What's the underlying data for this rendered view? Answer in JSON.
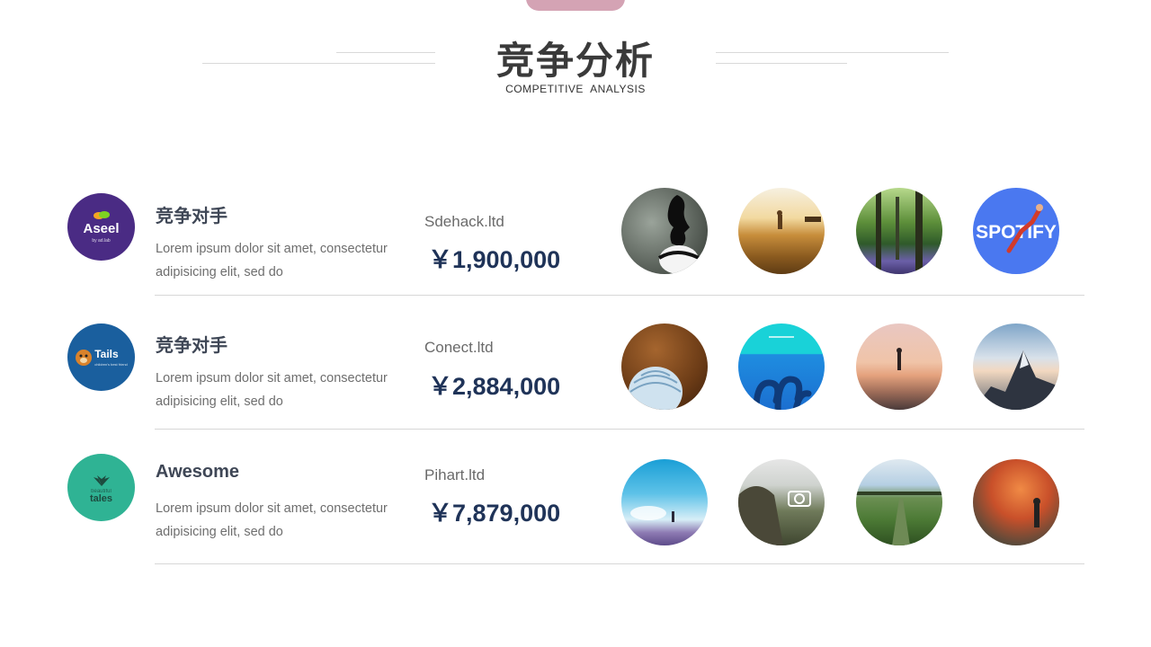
{
  "header": {
    "title": "竞争分析",
    "subtitle": "COMPETITIVE  ANALYSIS",
    "accent_color": "#d4a3b4"
  },
  "rows": [
    {
      "logo": {
        "text": "Aseel",
        "sub": "by ad.lab",
        "color": "#4a2b84"
      },
      "title": "竞争对手",
      "description": "Lorem ipsum dolor sit amet, consectetur adipisicing elit, sed do",
      "company": "Sdehack.ltd",
      "amount": "￥1,900,000",
      "thumbnails": [
        "silhouette-photo",
        "wheat-field-photo",
        "forest-photo",
        "spotify-athlete-photo"
      ],
      "spotify_text": "SPOTIFY"
    },
    {
      "logo": {
        "text": "Tails",
        "sub": "children's best friend",
        "color": "#1a5f9e"
      },
      "title": "竞争对手",
      "description": "Lorem ipsum dolor sit amet, consectetur adipisicing elit, sed do",
      "company": "Conect.ltd",
      "amount": "￥2,884,000",
      "thumbnails": [
        "hot-air-balloon-photo",
        "octopus-illustration",
        "beach-sunset-photo",
        "mountain-peak-photo"
      ]
    },
    {
      "logo": {
        "text": "tales",
        "sub": "beautiful",
        "color": "#2fb394"
      },
      "title": "Awesome",
      "description": "Lorem ipsum dolor sit amet, consectetur adipisicing elit, sed do",
      "company": "Pihart.ltd",
      "amount": "￥7,879,000",
      "thumbnails": [
        "lavender-sky-photo",
        "photographer-portfolio-photo",
        "green-field-photo",
        "orange-smoke-photo"
      ]
    }
  ]
}
